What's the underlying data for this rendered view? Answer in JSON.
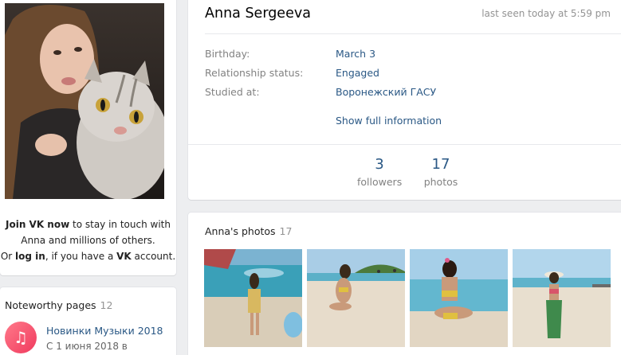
{
  "profile": {
    "name": "Anna Sergeeva",
    "last_seen": "last seen today at 5:59 pm",
    "info": [
      {
        "label": "Birthday:",
        "value": "March 3"
      },
      {
        "label": "Relationship status:",
        "value": "Engaged"
      },
      {
        "label": "Studied at:",
        "value": "Воронежский ГАСУ"
      }
    ],
    "show_full": "Show full information",
    "counters": [
      {
        "num": "3",
        "label": "followers"
      },
      {
        "num": "17",
        "label": "photos"
      }
    ]
  },
  "join": {
    "bold1": "Join VK now",
    "text1": " to stay in touch with",
    "line2": "Anna and millions of others.",
    "pre3": "Or ",
    "login": "log in",
    "mid3": ", if you have a ",
    "vk": "VK",
    "post3": " account."
  },
  "pages": {
    "title": "Noteworthy pages",
    "count": "12",
    "item": {
      "name": "Новинки Музыки 2018",
      "sub": "С 1 июня 2018 в",
      "icon": "music-note-icon"
    }
  },
  "photos": {
    "title": "Anna's photos",
    "count": "17"
  },
  "colors": {
    "link": "#2a5885",
    "muted": "#828282",
    "background": "#edeef0"
  }
}
